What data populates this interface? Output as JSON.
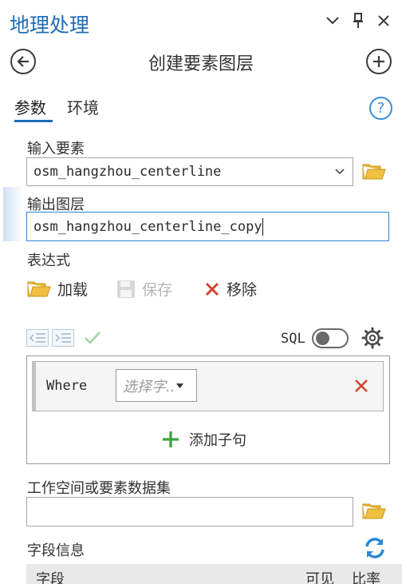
{
  "panel": {
    "title": "地理处理",
    "controls": {
      "collapse": "∨",
      "pin": "pin",
      "close": "×"
    }
  },
  "tool": {
    "title": "创建要素图层",
    "back": "back",
    "add": "add"
  },
  "tabs": [
    {
      "label": "参数",
      "active": true
    },
    {
      "label": "环境",
      "active": false
    }
  ],
  "help": "?",
  "params": {
    "input_label": "输入要素",
    "input_value": "osm_hangzhou_centerline",
    "output_label": "输出图层",
    "output_value": "osm_hangzhou_centerline_copy",
    "expression_label": "表达式",
    "load_label": "加载",
    "save_label": "保存",
    "remove_label": "移除",
    "sql_label": "SQL",
    "where_keyword": "Where",
    "field_placeholder": "选择字..",
    "add_clause_label": "添加子句",
    "workspace_label": "工作空间或要素数据集",
    "workspace_value": "",
    "field_info_label": "字段信息",
    "field_info_columns": [
      "字段",
      "可见",
      "比率"
    ]
  },
  "colors": {
    "accent": "#1e6eb8",
    "folder": "#e8b530",
    "remove_red": "#d0452f",
    "add_green": "#3aa33a"
  }
}
